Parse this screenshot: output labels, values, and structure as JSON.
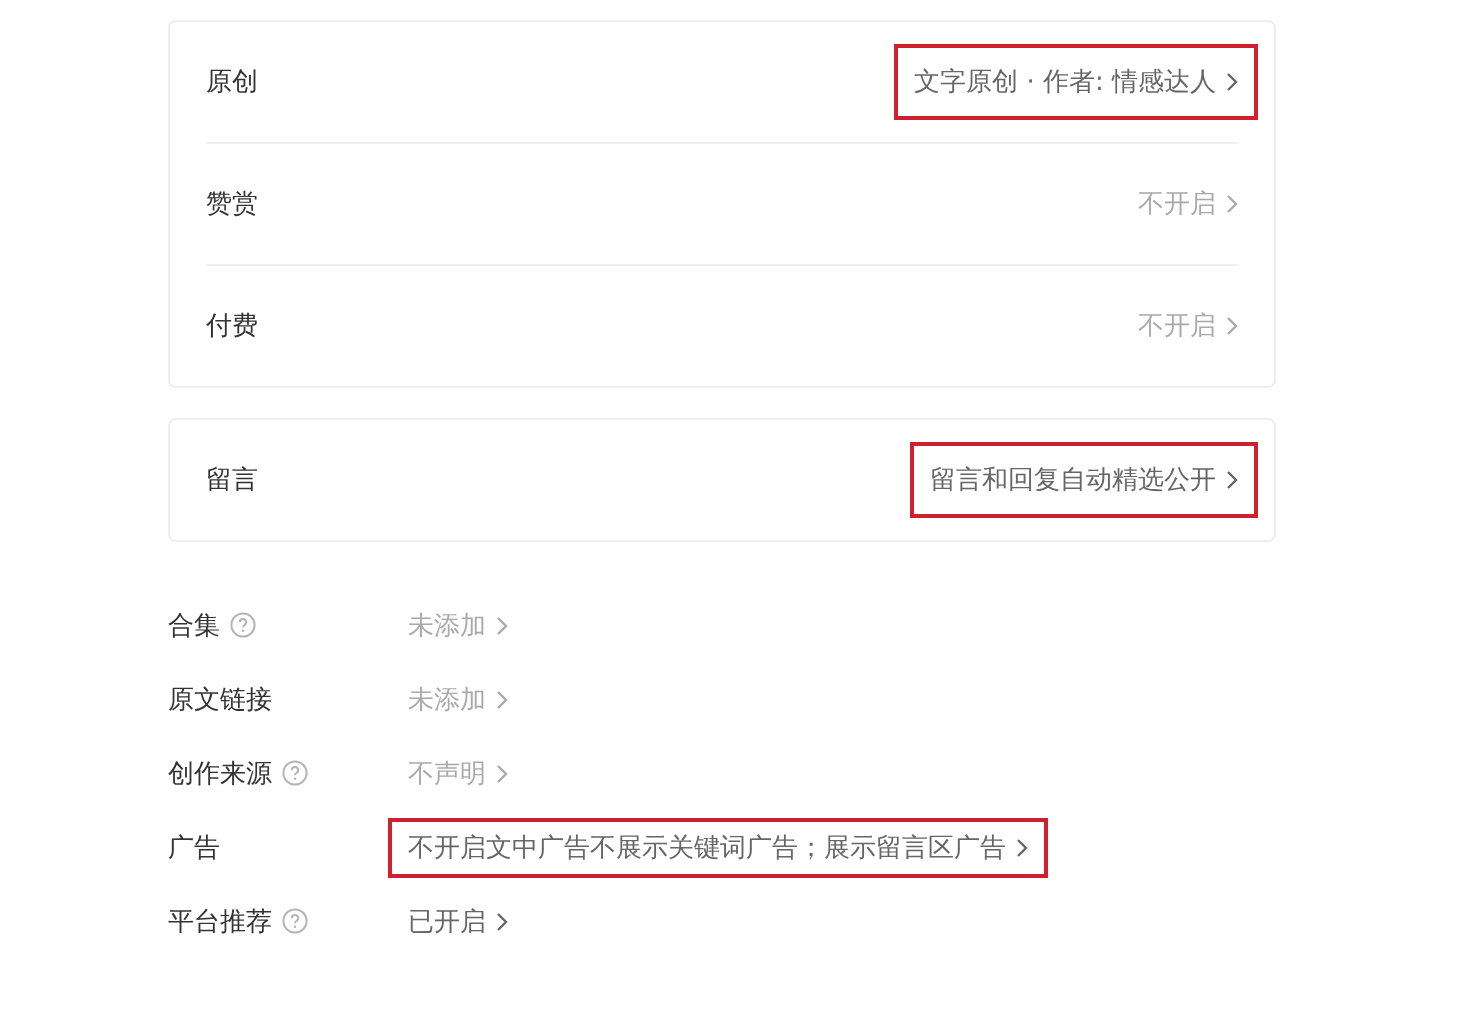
{
  "cards": [
    {
      "rows": [
        {
          "label": "原创",
          "value": "文字原创 · 作者: 情感达人",
          "dim": false,
          "highlighted": true
        },
        {
          "label": "赞赏",
          "value": "不开启",
          "dim": true,
          "highlighted": false
        },
        {
          "label": "付费",
          "value": "不开启",
          "dim": true,
          "highlighted": false
        }
      ]
    },
    {
      "rows": [
        {
          "label": "留言",
          "value": "留言和回复自动精选公开",
          "dim": false,
          "highlighted": true
        }
      ]
    }
  ],
  "settings": [
    {
      "label": "合集",
      "help": true,
      "value": "未添加",
      "dim": true,
      "highlighted": false
    },
    {
      "label": "原文链接",
      "help": false,
      "value": "未添加",
      "dim": true,
      "highlighted": false
    },
    {
      "label": "创作来源",
      "help": true,
      "value": "不声明",
      "dim": true,
      "highlighted": false
    },
    {
      "label": "广告",
      "help": false,
      "value": "不开启文中广告不展示关键词广告；展示留言区广告",
      "dim": false,
      "highlighted": true
    },
    {
      "label": "平台推荐",
      "help": true,
      "value": "已开启",
      "dim": false,
      "highlighted": false
    }
  ]
}
